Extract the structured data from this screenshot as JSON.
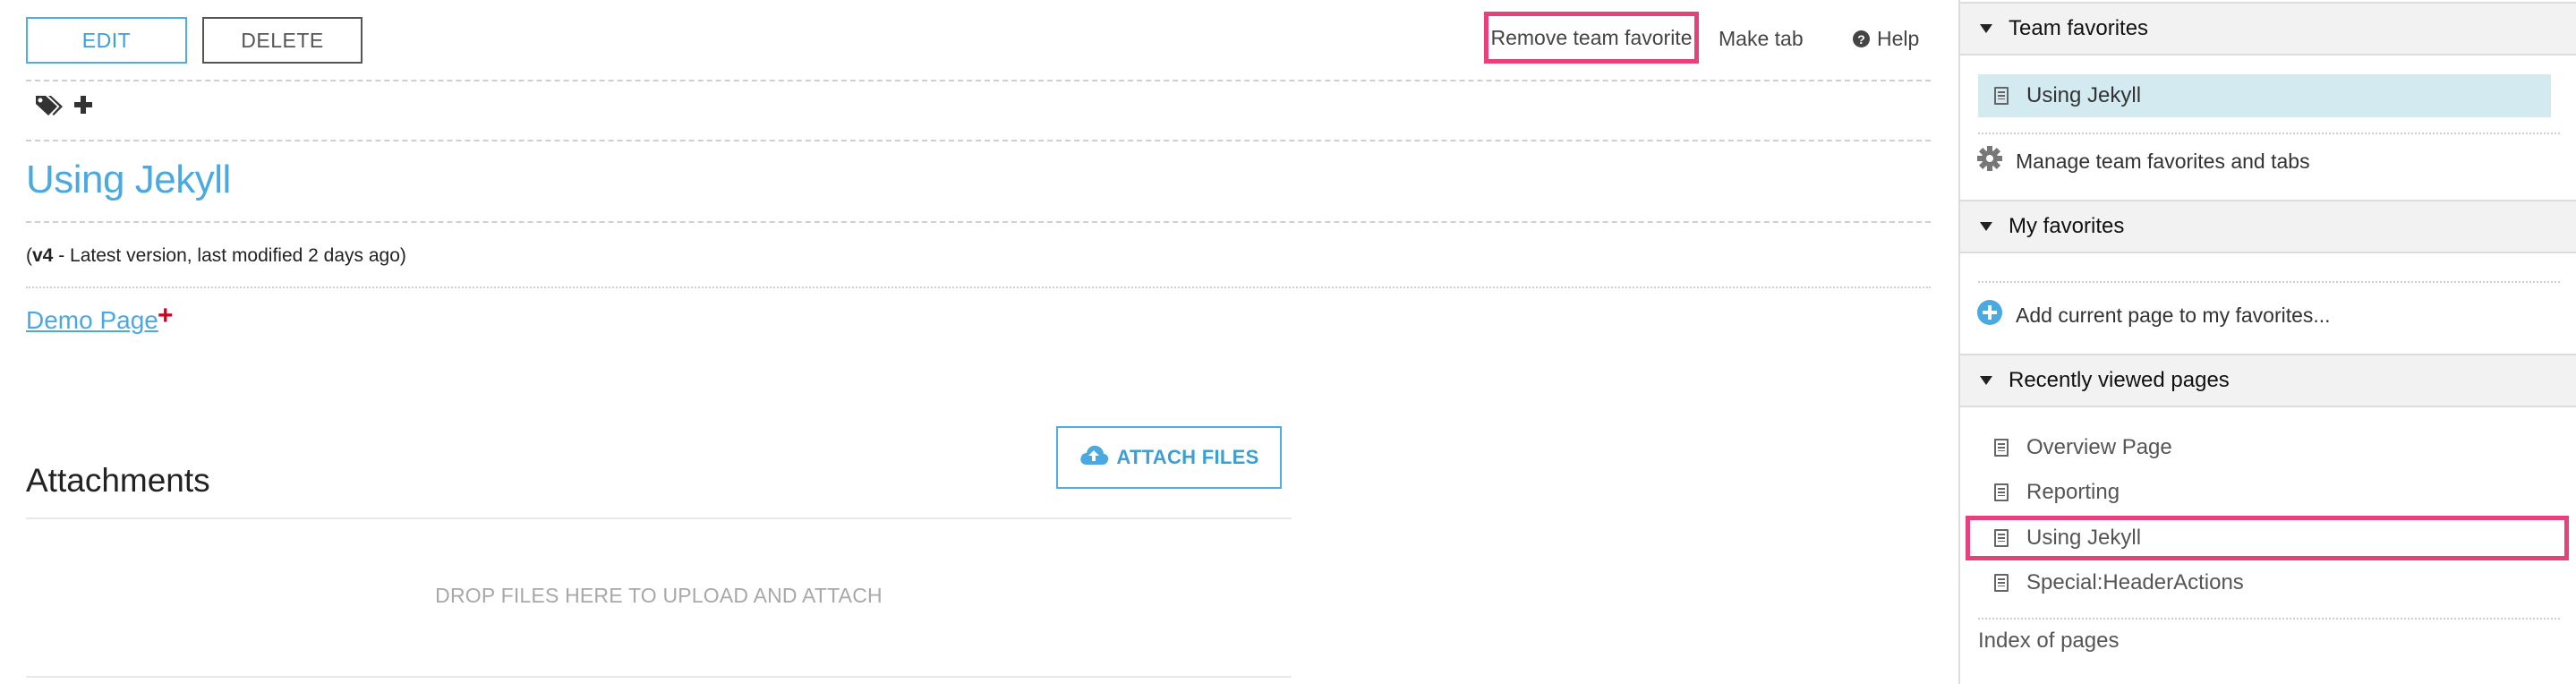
{
  "toolbar": {
    "edit_label": "EDIT",
    "delete_label": "DELETE",
    "remove_favorite_label": "Remove team favorite",
    "make_tab_label": "Make tab",
    "help_label": "Help"
  },
  "page": {
    "title": "Using Jekyll",
    "version_number": "v4",
    "version_suffix": " - Latest version, last modified 2 days ago)",
    "version_prefix": "(",
    "link_label": "Demo Page",
    "link_plus": "+"
  },
  "attachments": {
    "title": "Attachments",
    "attach_button_label": "ATTACH FILES",
    "drop_text": "DROP FILES HERE TO UPLOAD AND ATTACH"
  },
  "sidebar": {
    "team_favorites": {
      "header": "Team favorites",
      "items": [
        "Using Jekyll"
      ],
      "manage_label": "Manage team favorites and tabs"
    },
    "my_favorites": {
      "header": "My favorites",
      "add_label": "Add current page to my favorites..."
    },
    "recent": {
      "header": "Recently viewed pages",
      "items": [
        "Overview Page",
        "Reporting",
        "Using Jekyll",
        "Special:HeaderActions"
      ]
    },
    "index_label": "Index of pages"
  },
  "colors": {
    "accent": "#4aa9e0",
    "highlight": "#e8407a",
    "favorite_bg": "#d3ebf0"
  },
  "icons": {
    "tags": "tags-icon",
    "add_tag": "plus-icon",
    "help": "question-circle-icon",
    "upload": "cloud-upload-icon",
    "gear": "gear-icon",
    "add_favorite": "plus-circle-icon",
    "page": "page-icon"
  }
}
